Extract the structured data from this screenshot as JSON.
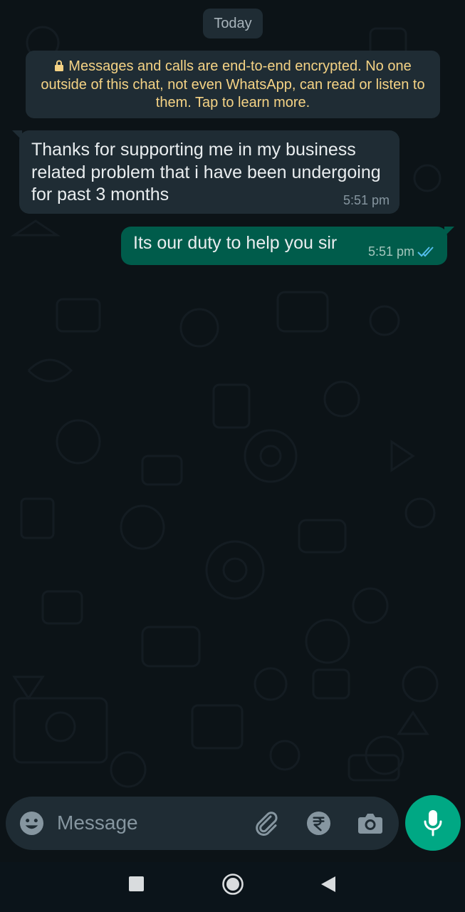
{
  "chat": {
    "date_chip": "Today",
    "encryption_notice": "Messages and calls are end-to-end encrypted. No one outside of this chat, not even WhatsApp, can read or listen to them. Tap to learn more.",
    "messages": [
      {
        "direction": "incoming",
        "text": "Thanks for supporting me in my business related problem that i have been undergoing for past 3 months",
        "time": "5:51 pm"
      },
      {
        "direction": "outgoing",
        "text": "Its our duty to help you sir",
        "time": "5:51 pm",
        "status": "read"
      }
    ]
  },
  "composer": {
    "placeholder": "Message",
    "icons": [
      "emoji-icon",
      "attach-icon",
      "rupee-icon",
      "camera-icon",
      "mic-icon"
    ]
  },
  "navigation": {
    "icons": [
      "recents-square-icon",
      "home-circle-icon",
      "back-triangle-icon"
    ]
  },
  "colors": {
    "background": "#0b141a",
    "incoming_bubble": "#1f2c34",
    "outgoing_bubble": "#005c4b",
    "accent": "#00a884",
    "notice_text": "#f5d385",
    "read_ticks": "#53bdeb"
  }
}
